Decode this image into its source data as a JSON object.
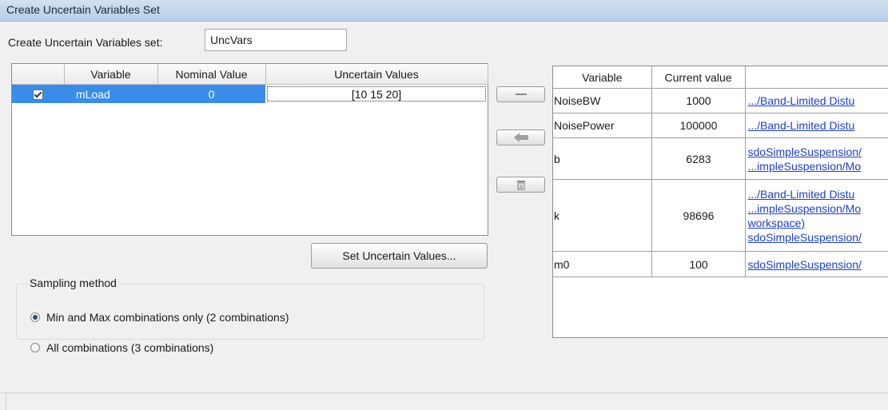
{
  "window": {
    "title": "Create Uncertain Variables Set"
  },
  "set_name": {
    "label": "Create Uncertain Variables set:",
    "value": "UncVars"
  },
  "uncertain_table": {
    "columns": [
      "Variable",
      "Nominal Value",
      "Uncertain Values"
    ],
    "rows": [
      {
        "checked": true,
        "variable": "mLoad",
        "nominal": "0",
        "uncertain": "[10 15 20]"
      }
    ]
  },
  "buttons": {
    "set_uncertain": "Set Uncertain Values...",
    "remove_icon": "minus-icon",
    "add_icon": "left-arrow-icon",
    "delete_icon": "trash-icon"
  },
  "sampling": {
    "title": "Sampling method",
    "options": [
      {
        "label": "Min and Max combinations only (2 combinations)",
        "selected": true
      },
      {
        "label": "All combinations (3 combinations)",
        "selected": false
      }
    ]
  },
  "workspace_table": {
    "columns": [
      "Variable",
      "Current value",
      ""
    ],
    "rows": [
      {
        "variable": "NoiseBW",
        "value": "1000",
        "links": [
          ".../Band-Limited Distu"
        ]
      },
      {
        "variable": "NoisePower",
        "value": "100000",
        "links": [
          ".../Band-Limited Distu"
        ]
      },
      {
        "variable": "b",
        "value": "6283",
        "links": [
          "sdoSimpleSuspension/",
          "...impleSuspension/Mo"
        ]
      },
      {
        "variable": "k",
        "value": "98696",
        "links": [
          ".../Band-Limited Distu",
          "...impleSuspension/Mo",
          "workspace)",
          "sdoSimpleSuspension/"
        ]
      },
      {
        "variable": "m0",
        "value": "100",
        "links": [
          "sdoSimpleSuspension/"
        ]
      }
    ]
  },
  "colors": {
    "selection": "#3b8ce8",
    "link": "#1c3fc1",
    "titlebar": "#c5d7ee"
  }
}
